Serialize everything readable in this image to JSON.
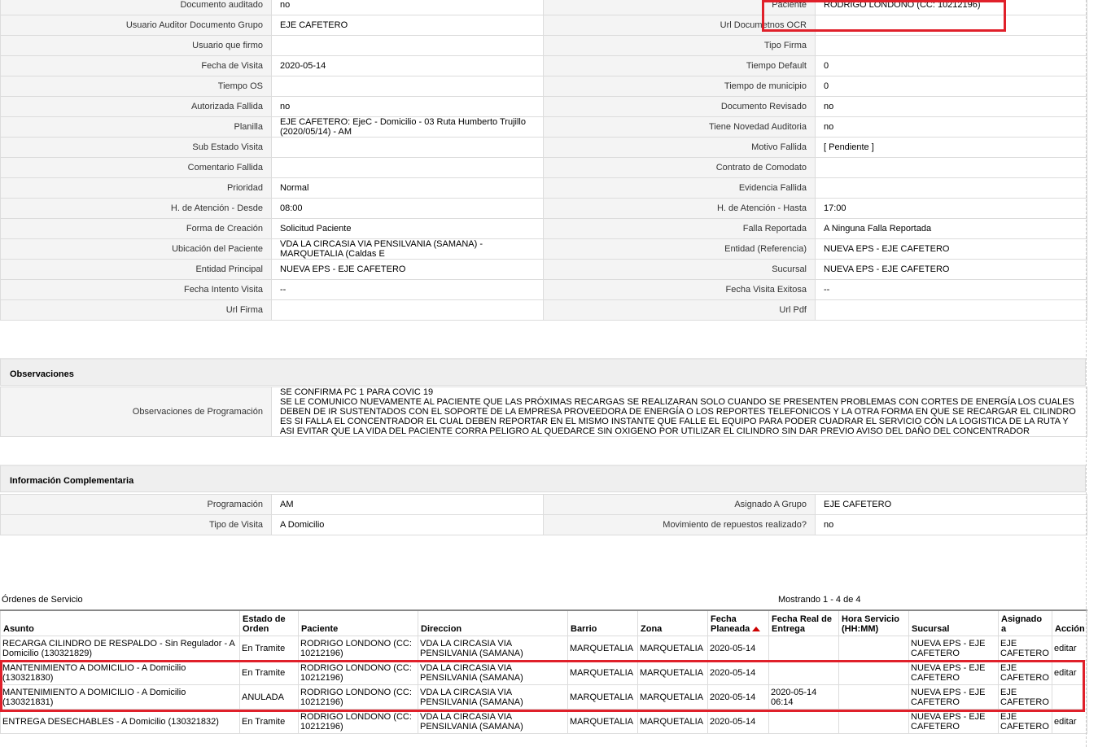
{
  "detail_rows": [
    {
      "l1": "Documento auditado",
      "v1": "no",
      "l2": "Paciente",
      "v2": "RODRIGO LONDONO (CC: 10212196)"
    },
    {
      "l1": "Usuario Auditor Documento Grupo",
      "v1": "EJE CAFETERO",
      "l2": "Url Documetnos OCR",
      "v2": ""
    },
    {
      "l1": "Usuario que firmo",
      "v1": "",
      "l2": "Tipo Firma",
      "v2": ""
    },
    {
      "l1": "Fecha de Visita",
      "v1": "2020-05-14",
      "l2": "Tiempo Default",
      "v2": "0"
    },
    {
      "l1": "Tiempo OS",
      "v1": "",
      "l2": "Tiempo de municipio",
      "v2": "0"
    },
    {
      "l1": "Autorizada Fallida",
      "v1": "no",
      "l2": "Documento Revisado",
      "v2": "no"
    },
    {
      "l1": "Planilla",
      "v1": "EJE CAFETERO: EjeC - Domicilio - 03 Ruta Humberto Trujillo (2020/05/14) - AM",
      "l2": "Tiene Novedad Auditoria",
      "v2": "no"
    },
    {
      "l1": "Sub Estado Visita",
      "v1": "",
      "l2": "Motivo Fallida",
      "v2": "[ Pendiente ]"
    },
    {
      "l1": "Comentario Fallida",
      "v1": "",
      "l2": "Contrato de Comodato",
      "v2": ""
    },
    {
      "l1": "Prioridad",
      "v1": "Normal",
      "l2": "Evidencia Fallida",
      "v2": ""
    },
    {
      "l1": "H. de Atención - Desde",
      "v1": "08:00",
      "l2": "H. de Atención - Hasta",
      "v2": "17:00"
    },
    {
      "l1": "Forma de Creación",
      "v1": "Solicitud Paciente",
      "l2": "Falla Reportada",
      "v2": "A Ninguna Falla Reportada"
    },
    {
      "l1": "Ubicación del Paciente",
      "v1": "VDA LA CIRCASIA VIA PENSILVANIA (SAMANA) - MARQUETALIA (Caldas E",
      "l2": "Entidad (Referencia)",
      "v2": "NUEVA EPS - EJE CAFETERO"
    },
    {
      "l1": "Entidad Principal",
      "v1": "NUEVA EPS - EJE CAFETERO",
      "l2": "Sucursal",
      "v2": "NUEVA EPS - EJE CAFETERO"
    },
    {
      "l1": "Fecha Intento Visita",
      "v1": "--",
      "l2": "Fecha Visita Exitosa",
      "v2": "--"
    },
    {
      "l1": "Url Firma",
      "v1": "",
      "l2": "Url Pdf",
      "v2": ""
    }
  ],
  "observaciones": {
    "header": "Observaciones",
    "label": "Observaciones de Programación",
    "text": " SE CONFIRMA PC 1 PARA COVIC 19\n SE LE COMUNICO NUEVAMENTE AL PACIENTE QUE LAS PRÓXIMAS RECARGAS SE REALIZARAN SOLO CUANDO SE PRESENTEN PROBLEMAS CON CORTES DE ENERGÍA LOS CUALES DEBEN DE IR SUSTENTADOS CON EL SOPORTE DE LA EMPRESA PROVEEDORA DE ENERGÍA O LOS REPORTES TELEFONICOS Y LA OTRA FORMA EN QUE SE RECARGAR EL CILINDRO ES SI FALLA EL CONCENTRADOR EL CUAL DEBEN REPORTAR EN EL MISMO INSTANTE QUE FALLE EL EQUIPO PARA PODER CUADRAR EL SERVICIO CON LA LOGISTICA DE LA RUTA Y ASI EVITAR QUE LA VIDA DEL PACIENTE CORRA PELIGRO AL QUEDARCE SIN OXIGENO POR UTILIZAR EL CILINDRO SIN DAR PREVIO AVISO DEL DAÑO DEL CONCENTRADOR"
  },
  "info": {
    "header": "Información Complementaria",
    "rows": [
      {
        "l1": "Programación",
        "v1": "AM",
        "l2": "Asignado A Grupo",
        "v2": "EJE CAFETERO"
      },
      {
        "l1": "Tipo de Visita",
        "v1": "A Domicilio",
        "l2": "Movimiento de repuestos realizado?",
        "v2": "no"
      }
    ]
  },
  "orders": {
    "title": "Órdenes de Servicio",
    "count": "Mostrando 1 - 4 de 4",
    "columns": [
      "Asunto",
      "Estado de Orden",
      "Paciente",
      "Direccion",
      "Barrio",
      "Zona",
      "Fecha Planeada",
      "Fecha Real de Entrega",
      "Hora Servicio (HH:MM)",
      "Sucursal",
      "Asignado a",
      "Acción"
    ],
    "sorted_column": "Fecha Planeada",
    "rows": [
      {
        "asunto": "RECARGA CILINDRO DE RESPALDO - Sin Regulador - A Domicilio (130321829)",
        "estado": "En Tramite",
        "paciente": "RODRIGO LONDONO (CC: 10212196)",
        "direccion": "VDA LA CIRCASIA VIA PENSILVANIA (SAMANA)",
        "barrio": "MARQUETALIA",
        "zona": "MARQUETALIA",
        "fecha": "2020-05-14",
        "real": "",
        "hora": "",
        "sucursal": "NUEVA EPS - EJE CAFETERO",
        "asignado": "EJE CAFETERO",
        "accion": "editar"
      },
      {
        "asunto": "MANTENIMIENTO A DOMICILIO - A Domicilio (130321830)",
        "estado": "En Tramite",
        "paciente": "RODRIGO LONDONO (CC: 10212196)",
        "direccion": "VDA LA CIRCASIA VIA PENSILVANIA (SAMANA)",
        "barrio": "MARQUETALIA",
        "zona": "MARQUETALIA",
        "fecha": "2020-05-14",
        "real": "",
        "hora": "",
        "sucursal": "NUEVA EPS - EJE CAFETERO",
        "asignado": "EJE CAFETERO",
        "accion": "editar"
      },
      {
        "asunto": "MANTENIMIENTO A DOMICILIO - A Domicilio (130321831)",
        "estado": "ANULADA",
        "paciente": "RODRIGO LONDONO (CC: 10212196)",
        "direccion": "VDA LA CIRCASIA VIA PENSILVANIA (SAMANA)",
        "barrio": "MARQUETALIA",
        "zona": "MARQUETALIA",
        "fecha": "2020-05-14",
        "real": "2020-05-14 06:14",
        "hora": "",
        "sucursal": "NUEVA EPS - EJE CAFETERO",
        "asignado": "EJE CAFETERO",
        "accion": ""
      },
      {
        "asunto": "ENTREGA DESECHABLES - A Domicilio (130321832)",
        "estado": "En Tramite",
        "paciente": "RODRIGO LONDONO (CC: 10212196)",
        "direccion": "VDA LA CIRCASIA VIA PENSILVANIA (SAMANA)",
        "barrio": "MARQUETALIA",
        "zona": "MARQUETALIA",
        "fecha": "2020-05-14",
        "real": "",
        "hora": "",
        "sucursal": "NUEVA EPS - EJE CAFETERO",
        "asignado": "EJE CAFETERO",
        "accion": "editar"
      }
    ]
  },
  "highlight_color": "#e0202a"
}
